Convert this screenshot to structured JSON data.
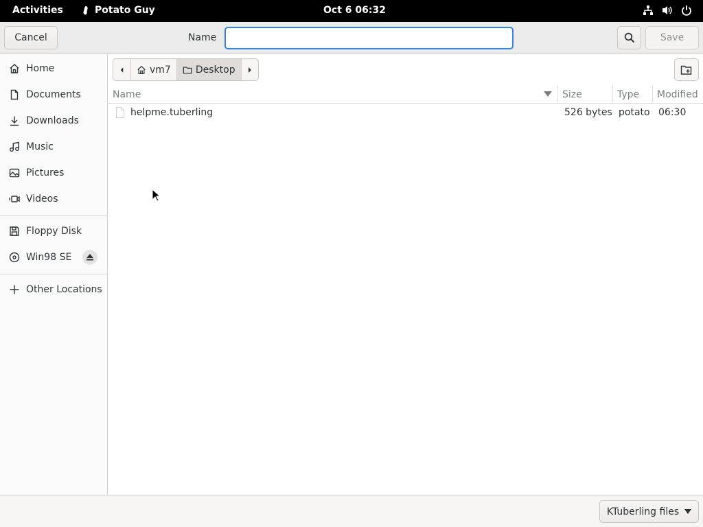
{
  "topbar": {
    "activities": "Activities",
    "app_name": "Potato Guy",
    "clock": "Oct 6  06:32"
  },
  "header": {
    "cancel_label": "Cancel",
    "name_label": "Name",
    "name_value": "",
    "save_label": "Save"
  },
  "sidebar": {
    "items": [
      {
        "label": "Home",
        "icon": "home-icon"
      },
      {
        "label": "Documents",
        "icon": "document-icon"
      },
      {
        "label": "Downloads",
        "icon": "download-icon"
      },
      {
        "label": "Music",
        "icon": "music-icon"
      },
      {
        "label": "Pictures",
        "icon": "picture-icon"
      },
      {
        "label": "Videos",
        "icon": "video-icon"
      }
    ],
    "devices": [
      {
        "label": "Floppy Disk",
        "icon": "floppy-icon"
      },
      {
        "label": "Win98 SE",
        "icon": "optical-disc-icon"
      }
    ],
    "other_locations": "Other Locations"
  },
  "pathbar": {
    "segments": [
      "vm7",
      "Desktop"
    ],
    "active_index": 1
  },
  "file_list": {
    "columns": [
      "Name",
      "Size",
      "Type",
      "Modified"
    ],
    "sort_column": "Name",
    "rows": [
      {
        "name": "helpme.tuberling",
        "size": "526 bytes",
        "type": "potato",
        "modified": "06:30"
      }
    ]
  },
  "footer": {
    "filter_label": "KTuberling files"
  },
  "colors": {
    "accent": "#3584e4",
    "topbar_bg": "#000000",
    "headerbar_bg": "#ebebeb",
    "sidebar_bg": "#fafafa"
  }
}
